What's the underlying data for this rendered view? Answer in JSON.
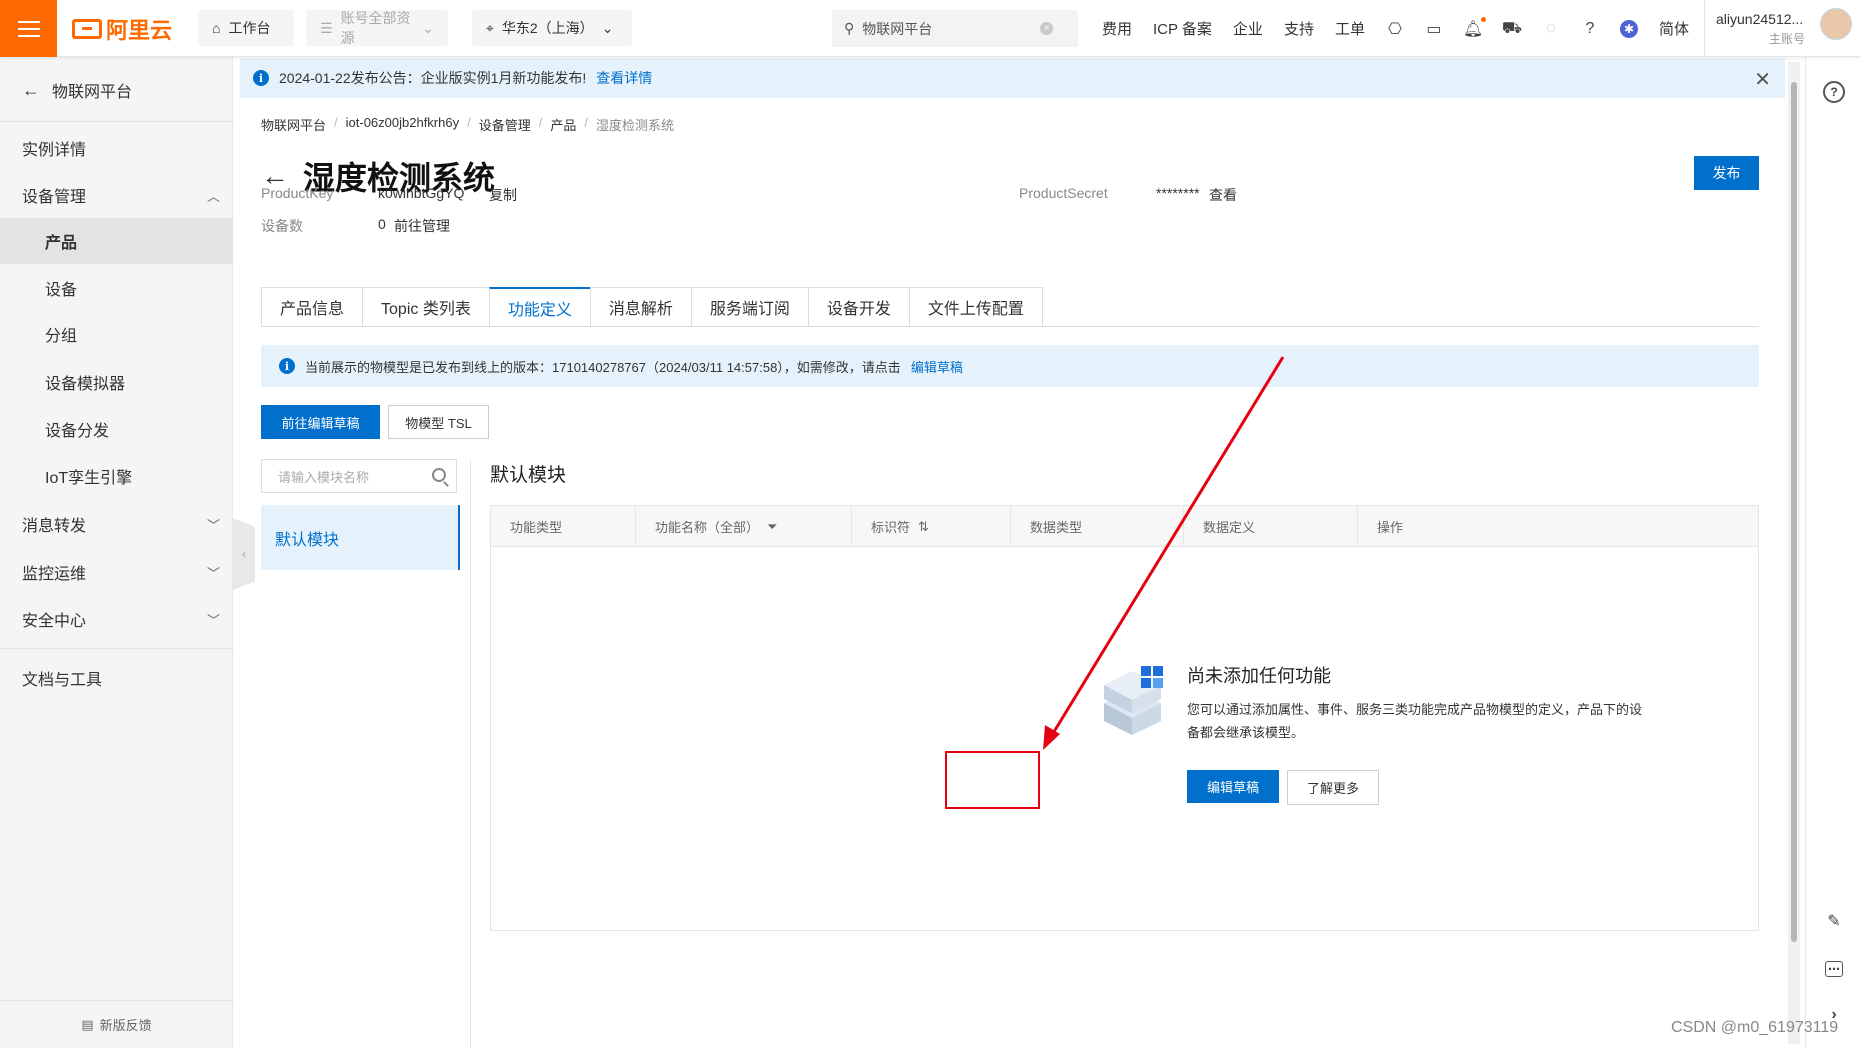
{
  "topbar": {
    "logo_text": "阿里云",
    "workbench": "工作台",
    "account_scope": "账号全部资源",
    "region": "华东2（上海）",
    "search_value": "物联网平台",
    "links": [
      "费用",
      "ICP 备案",
      "企业",
      "支持",
      "工单"
    ],
    "lang": "简体",
    "user_name": "aliyun24512...",
    "user_role": "主账号"
  },
  "sidebar": {
    "back_label": "物联网平台",
    "items": [
      {
        "label": "实例详情"
      },
      {
        "label": "设备管理"
      },
      {
        "label": "产品"
      },
      {
        "label": "设备"
      },
      {
        "label": "分组"
      },
      {
        "label": "设备模拟器"
      },
      {
        "label": "设备分发"
      },
      {
        "label": "IoT孪生引擎"
      },
      {
        "label": "消息转发"
      },
      {
        "label": "监控运维"
      },
      {
        "label": "安全中心"
      },
      {
        "label": "文档与工具"
      }
    ],
    "feedback": "新版反馈"
  },
  "notice": {
    "text": "2024-01-22发布公告：企业版实例1月新功能发布!",
    "link": "查看详情"
  },
  "breadcrumb": [
    "物联网平台",
    "iot-06z00jb2hfkrh6y",
    "设备管理",
    "产品",
    "湿度检测系统"
  ],
  "page": {
    "title": "湿度检测系统",
    "publish": "发布",
    "product_key_label": "ProductKey",
    "product_key_value": "k0wihbtGgYQ",
    "copy": "复制",
    "product_secret_label": "ProductSecret",
    "product_secret_value": "********",
    "view": "查看",
    "device_count_label": "设备数",
    "device_count_value": "0",
    "go_manage": "前往管理"
  },
  "tabs": [
    "产品信息",
    "Topic 类列表",
    "功能定义",
    "消息解析",
    "服务端订阅",
    "设备开发",
    "文件上传配置"
  ],
  "info_bar": {
    "text": "当前展示的物模型是已发布到线上的版本：1710140278767（2024/03/11 14:57:58），如需修改，请点击",
    "link": "编辑草稿"
  },
  "actions": {
    "go_draft": "前往编辑草稿",
    "tsl": "物模型 TSL"
  },
  "modules": {
    "search_placeholder": "请输入模块名称",
    "active": "默认模块",
    "section_title": "默认模块"
  },
  "table": {
    "columns": [
      "功能类型",
      "功能名称（全部）",
      "标识符",
      "数据类型",
      "数据定义",
      "操作"
    ]
  },
  "empty": {
    "title": "尚未添加任何功能",
    "desc": "您可以通过添加属性、事件、服务三类功能完成产品物模型的定义，产品下的设备都会继承该模型。",
    "edit_draft": "编辑草稿",
    "learn_more": "了解更多"
  },
  "watermark": "CSDN @m0_61973119",
  "colors": {
    "brand": "#ff6a00",
    "primary": "#0070cc",
    "annotation": "#e60012"
  }
}
